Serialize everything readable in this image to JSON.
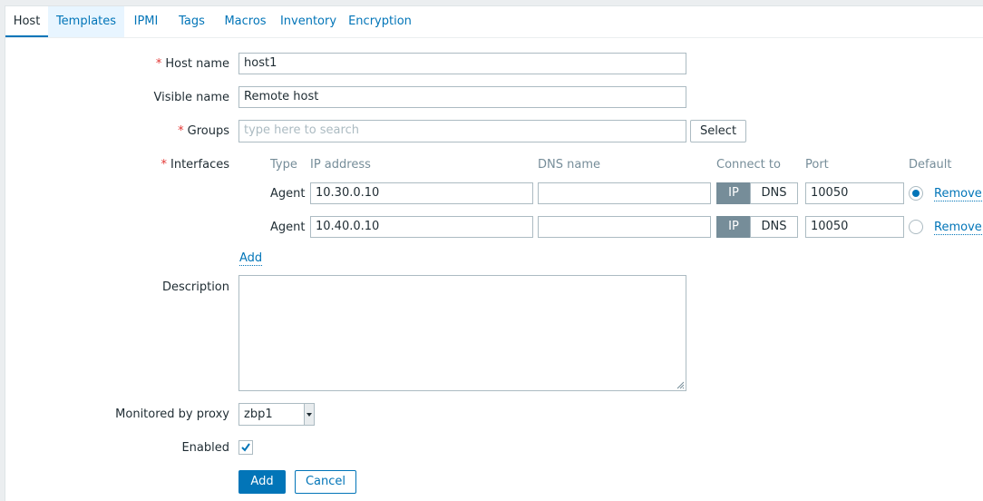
{
  "tabs": [
    {
      "label": "Host",
      "active": true
    },
    {
      "label": "Templates",
      "active": false
    },
    {
      "label": "IPMI",
      "active": false
    },
    {
      "label": "Tags",
      "active": false
    },
    {
      "label": "Macros",
      "active": false
    },
    {
      "label": "Inventory",
      "active": false
    },
    {
      "label": "Encryption",
      "active": false
    }
  ],
  "form": {
    "host_name": {
      "label": "Host name",
      "required": "*",
      "value": "host1"
    },
    "visible_name": {
      "label": "Visible name",
      "value": "Remote host"
    },
    "groups": {
      "label": "Groups",
      "required": "*",
      "placeholder": "type here to search",
      "select_label": "Select"
    },
    "interfaces": {
      "label": "Interfaces",
      "required": "*",
      "headers": {
        "type": "Type",
        "ip": "IP address",
        "dns": "DNS name",
        "connect": "Connect to",
        "port": "Port",
        "default": "Default"
      },
      "rows": [
        {
          "type": "Agent",
          "ip": "10.30.0.10",
          "dns": "",
          "connect_ip": "IP",
          "connect_dns": "DNS",
          "connect_selected": "IP",
          "port": "10050",
          "default": true,
          "remove": "Remove"
        },
        {
          "type": "Agent",
          "ip": "10.40.0.10",
          "dns": "",
          "connect_ip": "IP",
          "connect_dns": "DNS",
          "connect_selected": "IP",
          "port": "10050",
          "default": false,
          "remove": "Remove"
        }
      ],
      "add_label": "Add"
    },
    "description": {
      "label": "Description",
      "value": ""
    },
    "proxy": {
      "label": "Monitored by proxy",
      "value": "zbp1"
    },
    "enabled": {
      "label": "Enabled",
      "checked": true
    },
    "buttons": {
      "add": "Add",
      "cancel": "Cancel"
    }
  },
  "colors": {
    "accent": "#0275b8",
    "required": "#e33734",
    "header": "#768d99"
  }
}
